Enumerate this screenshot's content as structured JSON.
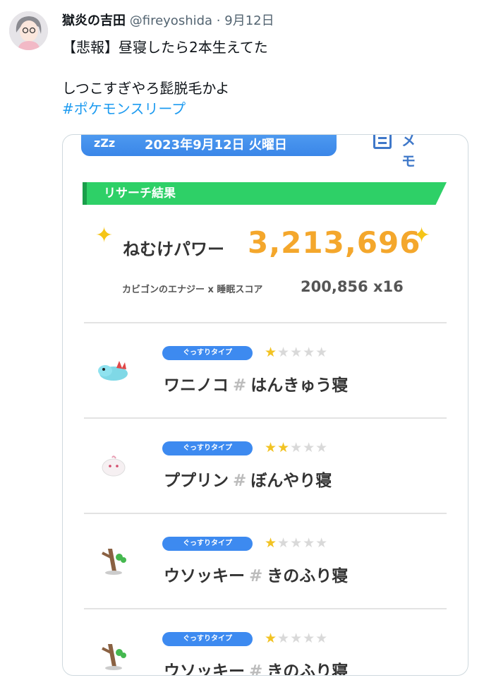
{
  "tweet": {
    "author_name": "獄炎の吉田",
    "handle": "@fireyoshida",
    "separator": "·",
    "date": "9月12日",
    "line1": "【悲報】昼寝したら2本生えてた",
    "line2": "しつこすぎやろ髭脱毛かよ",
    "hashtag": "#ポケモンスリープ"
  },
  "screenshot": {
    "zz": "zZz",
    "date_banner": "2023年9月12日 火曜日",
    "memo": "メモ",
    "section_title": "リサーチ結果",
    "power_label": "ねむけパワー",
    "power_value": "3,213,696",
    "energy_label": "カビゴンのエナジー x 睡眠スコア",
    "energy_value": "200,856 x16",
    "pokemon": [
      {
        "type": "ぐっすりタイプ",
        "name": "ワニノコ",
        "hash": "#",
        "sleep": "はんきゅう寝",
        "stars": 1,
        "sprite": "totodile"
      },
      {
        "type": "ぐっすりタイプ",
        "name": "ププリン",
        "hash": "#",
        "sleep": "ぼんやり寝",
        "stars": 2,
        "sprite": "igglybuff"
      },
      {
        "type": "ぐっすりタイプ",
        "name": "ウソッキー",
        "hash": "#",
        "sleep": "きのふり寝",
        "stars": 1,
        "sprite": "sudowoodo"
      },
      {
        "type": "ぐっすりタイプ",
        "name": "ウソッキー",
        "hash": "#",
        "sleep": "きのふり寝",
        "stars": 1,
        "sprite": "sudowoodo"
      }
    ]
  },
  "colors": {
    "link": "#1d9bf0",
    "power": "#f4a72c",
    "section": "#2ed067",
    "badge": "#3d8af0"
  }
}
